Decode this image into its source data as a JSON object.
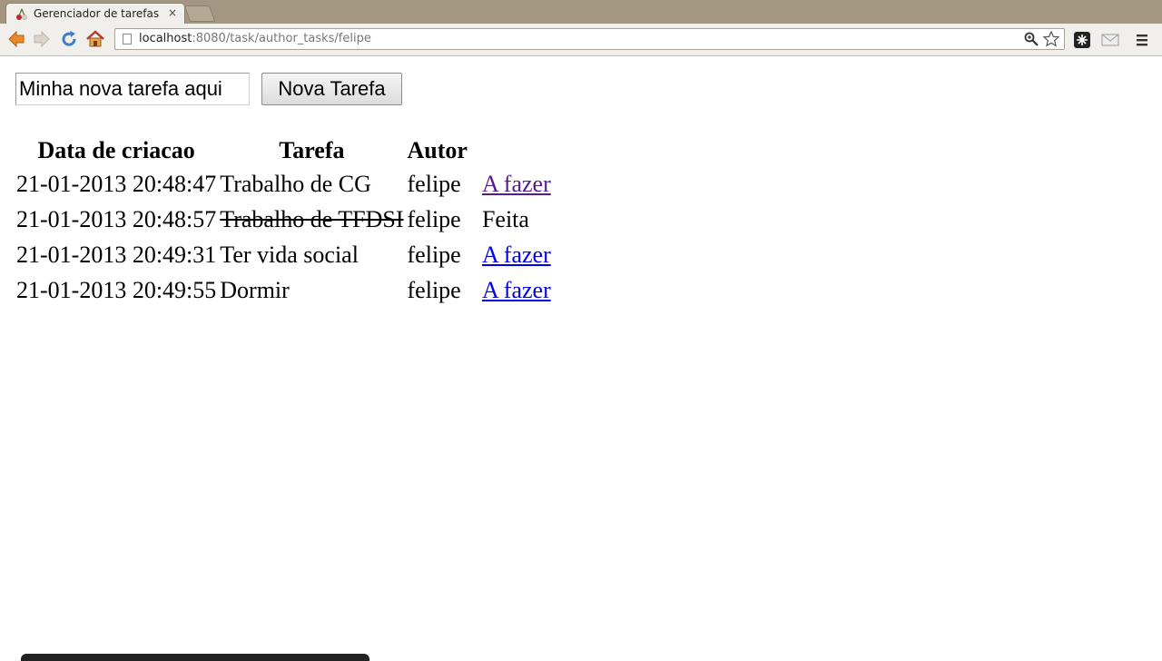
{
  "browser": {
    "tab_title": "Gerenciador de tarefas",
    "tab_close": "×",
    "url_host": "localhost",
    "url_rest": ":8080/task/author_tasks/felipe"
  },
  "form": {
    "input_value": "Minha nova tarefa aqui",
    "button_label": "Nova Tarefa"
  },
  "table": {
    "headers": [
      "Data de criacao",
      "Tarefa",
      "Autor"
    ],
    "rows": [
      {
        "date": "21-01-2013 20:48:47",
        "task": "Trabalho de CG",
        "author": "felipe",
        "status": "A fazer"
      },
      {
        "date": "21-01-2013 20:48:57",
        "task": "Trabalho de TFDSI",
        "author": "felipe",
        "status": "Feita"
      },
      {
        "date": "21-01-2013 20:49:31",
        "task": "Ter vida social",
        "author": "felipe",
        "status": "A fazer"
      },
      {
        "date": "21-01-2013 20:49:55",
        "task": "Dormir",
        "author": "felipe",
        "status": "A fazer"
      }
    ]
  },
  "colors": {
    "tabstrip": "#a49781",
    "link": "#0000ee",
    "visited_link": "#551a8b"
  }
}
